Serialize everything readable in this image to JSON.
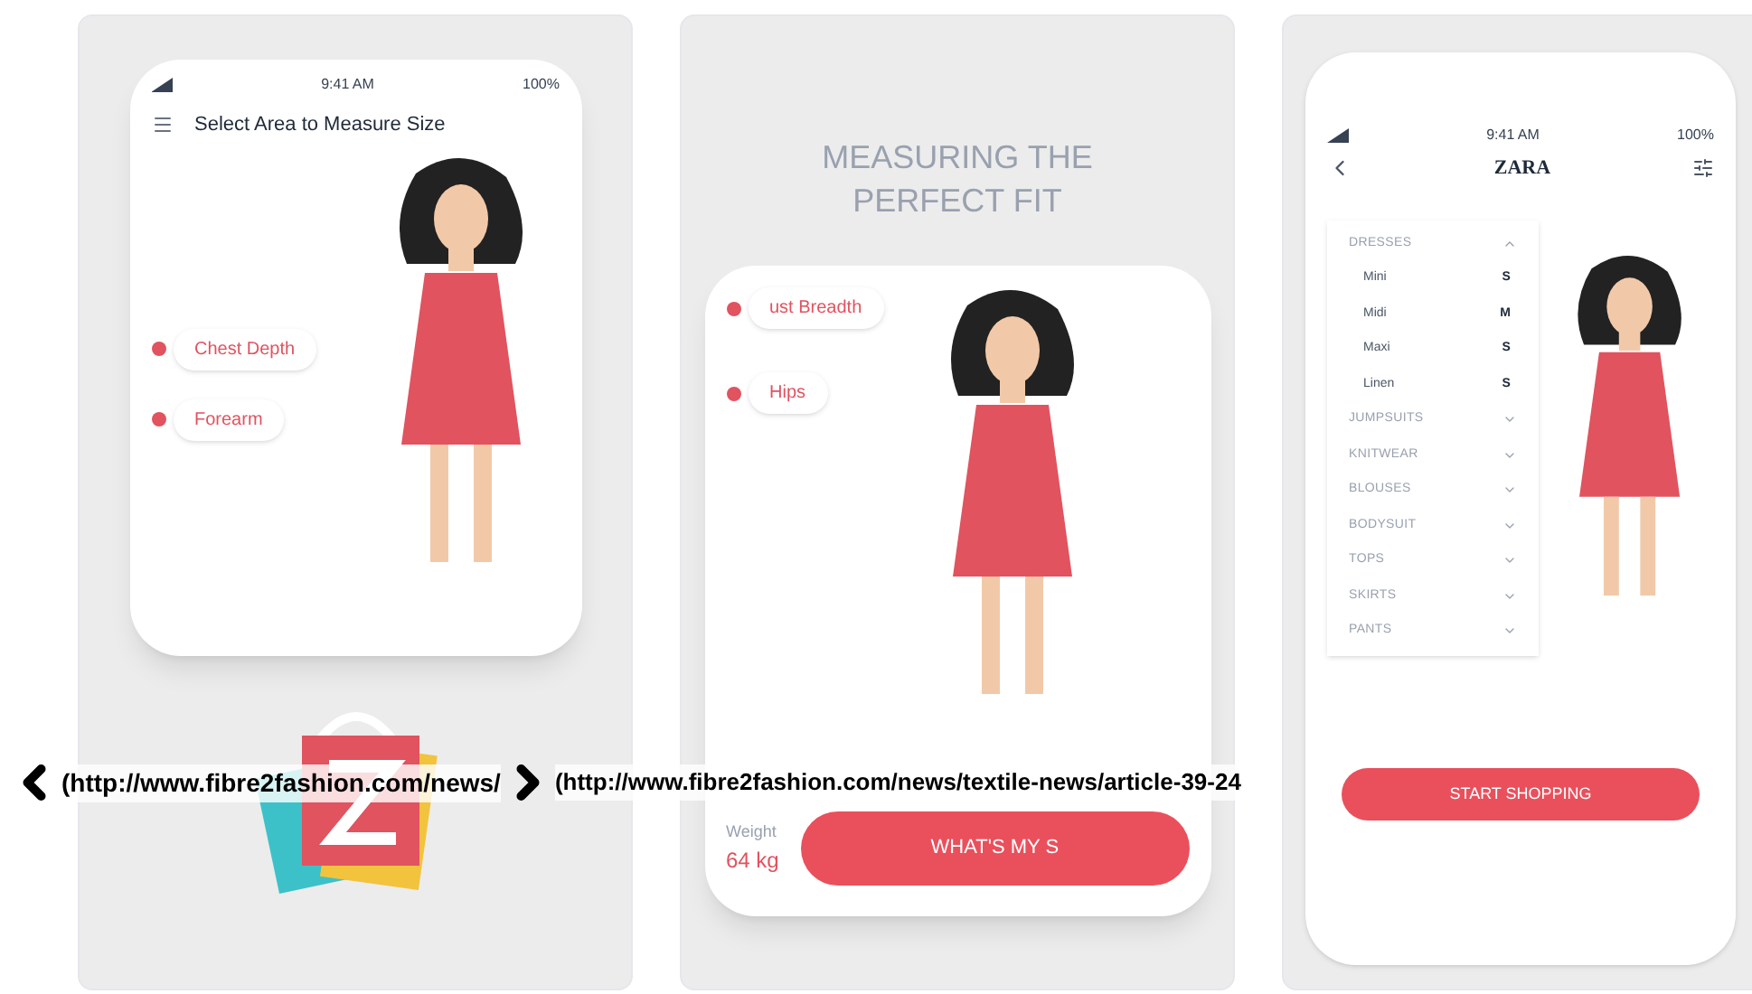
{
  "cards": [
    {
      "kind": "measure",
      "status": {
        "time": "9:41 AM",
        "battery": "100%"
      },
      "title": "Select Area to Measure Size",
      "chips": [
        "Chest Depth",
        "Forearm"
      ]
    },
    {
      "kind": "promo",
      "heading": "MEASURING THE PERFECT FIT",
      "chips": [
        "ust Breadth",
        "Hips"
      ],
      "weight_label": "Weight",
      "weight": "64 kg",
      "button": "WHAT'S MY S"
    },
    {
      "kind": "shop",
      "status": {
        "time": "9:41 AM",
        "battery": "100%"
      },
      "brand": "ZARA",
      "categories": [
        {
          "name": "DRESSES",
          "expanded": true,
          "children": [
            {
              "name": "Mini",
              "size": "S"
            },
            {
              "name": "Midi",
              "size": "M"
            },
            {
              "name": "Maxi",
              "size": "S"
            },
            {
              "name": "Linen",
              "size": "S"
            }
          ]
        },
        {
          "name": "JUMPSUITS",
          "expanded": false
        },
        {
          "name": "KNITWEAR",
          "expanded": false
        },
        {
          "name": "BLOUSES",
          "expanded": false
        },
        {
          "name": "BODYSUIT",
          "expanded": false
        },
        {
          "name": "TOPS",
          "expanded": false
        },
        {
          "name": "SKIRTS",
          "expanded": false
        },
        {
          "name": "PANTS",
          "expanded": false
        }
      ],
      "button": "START SHOPPING"
    }
  ],
  "links": [
    "(http://www.fibre2fashion.com/news/",
    "(http://www.fibre2fashion.com/news/textile-news/article-39-24"
  ]
}
